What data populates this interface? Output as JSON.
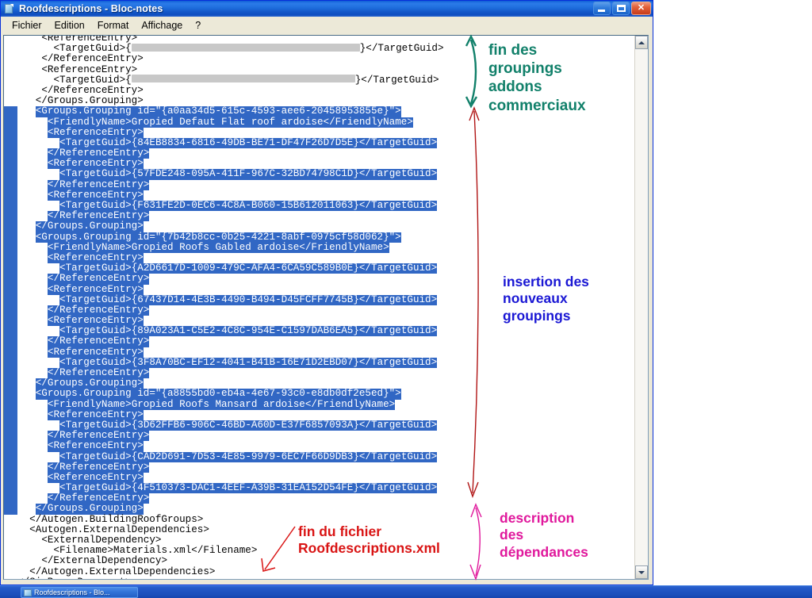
{
  "window": {
    "title": "Roofdescriptions - Bloc-notes",
    "icon": "notepad-document-icon",
    "minimize_label": "",
    "maximize_label": "",
    "close_label": "✕"
  },
  "menu": {
    "items": [
      {
        "label": "Fichier"
      },
      {
        "label": "Edition"
      },
      {
        "label": "Format"
      },
      {
        "label": "Affichage"
      },
      {
        "label": "?"
      }
    ]
  },
  "editor": {
    "lines": [
      {
        "indent": 4,
        "text": "<ReferenceEntry>",
        "sel": false
      },
      {
        "indent": 6,
        "text": "<TargetGuid>{",
        "redacted": true,
        "redact_width": 288,
        "tail": "}</TargetGuid>",
        "sel": false
      },
      {
        "indent": 4,
        "text": "</ReferenceEntry>",
        "sel": false
      },
      {
        "indent": 4,
        "text": "<ReferenceEntry>",
        "sel": false
      },
      {
        "indent": 6,
        "text": "<TargetGuid>{",
        "redacted": true,
        "redact_width": 282,
        "tail": "}</TargetGuid>",
        "sel": false
      },
      {
        "indent": 4,
        "text": "</ReferenceEntry>",
        "sel": false
      },
      {
        "indent": 3,
        "text": "</Groups.Grouping>",
        "sel": false
      },
      {
        "indent": 3,
        "text": "<Groups.Grouping id=\"{a0aa34d5-615c-4593-aee6-20458953855e}\">",
        "sel": true
      },
      {
        "indent": 5,
        "text": "<FriendlyName>Gropied Defaut Flat roof ardoise</FriendlyName>",
        "sel": true
      },
      {
        "indent": 5,
        "text": "<ReferenceEntry>",
        "sel": true
      },
      {
        "indent": 7,
        "text": "<TargetGuid>{84EB8834-6816-49DB-BE71-DF47F26D7D5E}</TargetGuid>",
        "sel": true
      },
      {
        "indent": 5,
        "text": "</ReferenceEntry>",
        "sel": true
      },
      {
        "indent": 5,
        "text": "<ReferenceEntry>",
        "sel": true
      },
      {
        "indent": 7,
        "text": "<TargetGuid>{57FDE248-095A-411F-967C-32BD74798C1D}</TargetGuid>",
        "sel": true
      },
      {
        "indent": 5,
        "text": "</ReferenceEntry>",
        "sel": true
      },
      {
        "indent": 5,
        "text": "<ReferenceEntry>",
        "sel": true
      },
      {
        "indent": 7,
        "text": "<TargetGuid>{F631FE2D-0EC6-4C8A-B060-15B612011063}</TargetGuid>",
        "sel": true
      },
      {
        "indent": 5,
        "text": "</ReferenceEntry>",
        "sel": true
      },
      {
        "indent": 3,
        "text": "</Groups.Grouping>",
        "sel": true
      },
      {
        "indent": 3,
        "text": "<Groups.Grouping id=\"{7b42b8cc-0b25-4221-8abf-0975cf58d062}\">",
        "sel": true
      },
      {
        "indent": 5,
        "text": "<FriendlyName>Gropied Roofs Gabled ardoise</FriendlyName>",
        "sel": true
      },
      {
        "indent": 5,
        "text": "<ReferenceEntry>",
        "sel": true
      },
      {
        "indent": 7,
        "text": "<TargetGuid>{A2D6617D-1009-479C-AFA4-6CA59C589B0E}</TargetGuid>",
        "sel": true
      },
      {
        "indent": 5,
        "text": "</ReferenceEntry>",
        "sel": true
      },
      {
        "indent": 5,
        "text": "<ReferenceEntry>",
        "sel": true
      },
      {
        "indent": 7,
        "text": "<TargetGuid>{67437D14-4E3B-4490-B494-D45FCFF7745B}</TargetGuid>",
        "sel": true
      },
      {
        "indent": 5,
        "text": "</ReferenceEntry>",
        "sel": true
      },
      {
        "indent": 5,
        "text": "<ReferenceEntry>",
        "sel": true
      },
      {
        "indent": 7,
        "text": "<TargetGuid>{89A023A1-C5E2-4C8C-954E-C1597DAB6EA5}</TargetGuid>",
        "sel": true
      },
      {
        "indent": 5,
        "text": "</ReferenceEntry>",
        "sel": true
      },
      {
        "indent": 5,
        "text": "<ReferenceEntry>",
        "sel": true
      },
      {
        "indent": 7,
        "text": "<TargetGuid>{3F8A70BC-EF12-4041-B41B-16E71D2EBD07}</TargetGuid>",
        "sel": true
      },
      {
        "indent": 5,
        "text": "</ReferenceEntry>",
        "sel": true
      },
      {
        "indent": 3,
        "text": "</Groups.Grouping>",
        "sel": true
      },
      {
        "indent": 3,
        "text": "<Groups.Grouping id=\"{a8855bd0-eb4a-4e67-93c0-e8db0df2e5ed}\">",
        "sel": true
      },
      {
        "indent": 5,
        "text": "<FriendlyName>Gropied Roofs Mansard ardoise</FriendlyName>",
        "sel": true
      },
      {
        "indent": 5,
        "text": "<ReferenceEntry>",
        "sel": true
      },
      {
        "indent": 7,
        "text": "<TargetGuid>{3D62FFB6-906C-46BD-A60D-E37F6857093A}</TargetGuid>",
        "sel": true
      },
      {
        "indent": 5,
        "text": "</ReferenceEntry>",
        "sel": true
      },
      {
        "indent": 5,
        "text": "<ReferenceEntry>",
        "sel": true
      },
      {
        "indent": 7,
        "text": "<TargetGuid>{CAD2D691-7D53-4E85-9979-6EC7F66D9DB3}</TargetGuid>",
        "sel": true
      },
      {
        "indent": 5,
        "text": "</ReferenceEntry>",
        "sel": true
      },
      {
        "indent": 5,
        "text": "<ReferenceEntry>",
        "sel": true
      },
      {
        "indent": 7,
        "text": "<TargetGuid>{4F510373-DAC1-4EEF-A39B-31EA152D54FE}</TargetGuid>",
        "sel": true
      },
      {
        "indent": 5,
        "text": "</ReferenceEntry>",
        "sel": true
      },
      {
        "indent": 3,
        "text": "</Groups.Grouping>",
        "sel": true
      },
      {
        "indent": 2,
        "text": "</Autogen.BuildingRoofGroups>",
        "sel": false
      },
      {
        "indent": 2,
        "text": "<Autogen.ExternalDependencies>",
        "sel": false
      },
      {
        "indent": 4,
        "text": "<ExternalDependency>",
        "sel": false
      },
      {
        "indent": 6,
        "text": "<Filename>Materials.xml</Filename>",
        "sel": false
      },
      {
        "indent": 4,
        "text": "</ExternalDependency>",
        "sel": false
      },
      {
        "indent": 2,
        "text": "</Autogen.ExternalDependencies>",
        "sel": false
      },
      {
        "indent": 0,
        "text": "</SimBase.Document>",
        "sel": false
      }
    ]
  },
  "scrollbar": {
    "up_arrow": "scroll-up-icon",
    "down_arrow": "scroll-down-icon"
  },
  "annotations": {
    "teal": {
      "text": "fin des\ngroupings\naddons\ncommerciaux",
      "color": "#11806a",
      "marker": "double-headed-arrow"
    },
    "blue": {
      "text": "insertion des\nnouveaux\ngroupings",
      "color": "#1a17d4",
      "marker": "double-headed-arrow"
    },
    "red": {
      "text": "fin du fichier\nRoofdescriptions.xml",
      "color": "#d91414",
      "marker": "pointer-arrow"
    },
    "magenta": {
      "text": "description\ndes\ndépendances",
      "color": "#e0189c",
      "marker": "brace-arrow"
    }
  },
  "taskbar": {
    "button_label": "Roofdescriptions - Blo...",
    "button_icon": "notepad-document-icon"
  }
}
